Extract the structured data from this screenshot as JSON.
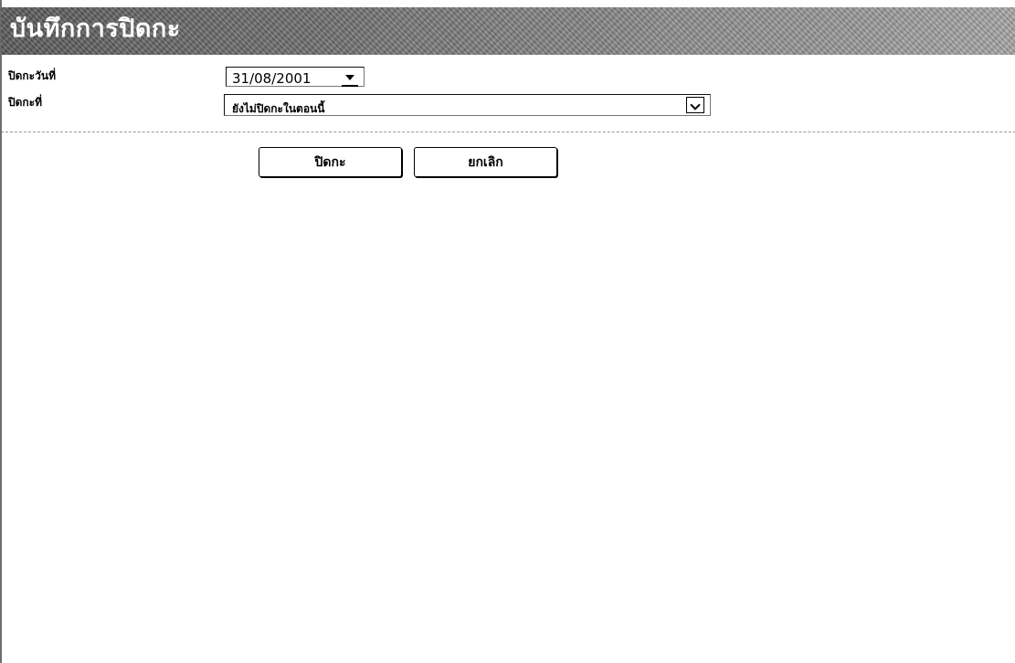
{
  "window": {
    "title": "บันทึกการปิดกะ"
  },
  "form": {
    "close_date_label": "ปิดกะวันที่",
    "close_date_value": "31/08/2001",
    "close_status_label": "ปิดกะที่",
    "close_status_value": "ยังไม่ปิดกะในตอนนี้"
  },
  "buttons": {
    "close_shift_label": "ปิดกะ",
    "cancel_label": "ยกเลิก"
  },
  "icons": {
    "date_dropdown": "chevron-down-icon",
    "status_dropdown": "chevron-down-icon"
  },
  "colors": {
    "title_bar": "#747474",
    "text": "#000000",
    "background": "#ffffff"
  }
}
